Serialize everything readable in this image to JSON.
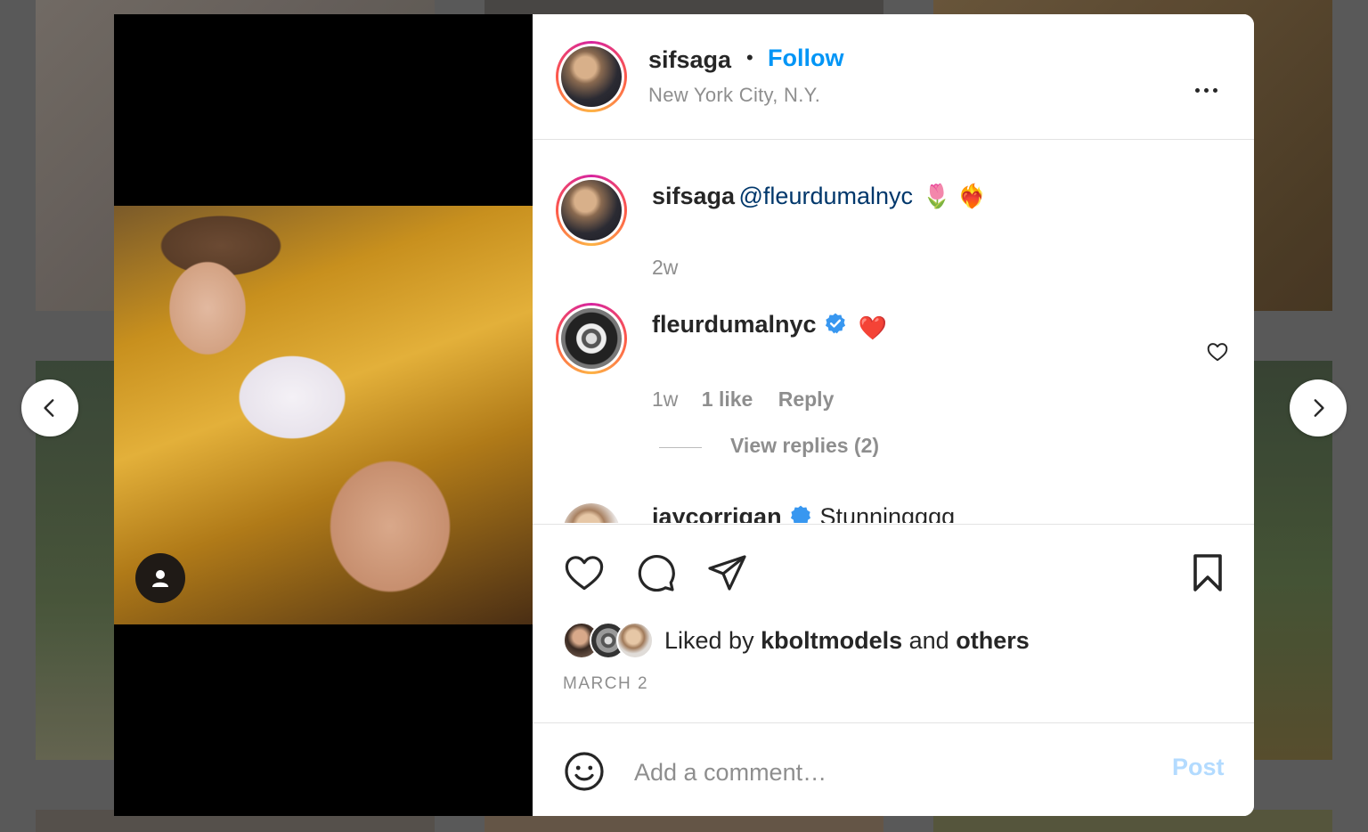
{
  "post": {
    "username": "sifsaga",
    "separator": "•",
    "follow_label": "Follow",
    "location": "New York City, N.Y.",
    "more_icon": "more-horizontal-icon"
  },
  "comments": [
    {
      "username": "sifsaga",
      "mention": "@fleurdumalnyc",
      "emoji": "🌷 ❤️‍🔥",
      "time": "2w"
    },
    {
      "username": "fleurdumalnyc",
      "verified": true,
      "emoji": "❤️",
      "time": "1w",
      "likes": "1 like",
      "reply_label": "Reply",
      "view_replies": "View replies (2)"
    },
    {
      "username": "jaycorrigan",
      "verified": true,
      "text": "Stunningggg"
    }
  ],
  "likes": {
    "prefix": "Liked by",
    "user": "kboltmodels",
    "conjunction": "and",
    "others": "others"
  },
  "date": "MARCH 2",
  "comment_box": {
    "placeholder": "Add a comment…",
    "post_label": "Post"
  },
  "colors": {
    "link": "#0095f6",
    "verified": "#3897f0",
    "post_disabled": "#b3dbff"
  }
}
